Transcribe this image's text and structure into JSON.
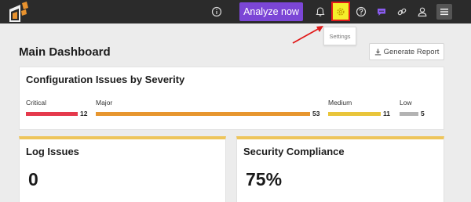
{
  "topbar": {
    "analyze_label": "Analyze now",
    "icons": [
      "info-icon",
      "bell-icon",
      "gear-icon",
      "help-icon",
      "chat-icon",
      "link-icon",
      "user-icon",
      "menu-icon"
    ],
    "accent": "#7b46d6",
    "highlight": "#f5ef2a"
  },
  "tooltip": {
    "text": "Settings"
  },
  "page": {
    "title": "Main Dashboard",
    "generate_report_label": "Generate Report"
  },
  "config_issues": {
    "title": "Configuration Issues by Severity",
    "severities": [
      {
        "label": "Critical",
        "count": "12",
        "color": "#e5394c"
      },
      {
        "label": "Major",
        "count": "53",
        "color": "#e7962f"
      },
      {
        "label": "Medium",
        "count": "11",
        "color": "#e9c53a"
      },
      {
        "label": "Low",
        "count": "5",
        "color": "#b3b3b3"
      }
    ]
  },
  "log_issues": {
    "title": "Log Issues",
    "value": "0"
  },
  "security_compliance": {
    "title": "Security Compliance",
    "value": "75%"
  }
}
